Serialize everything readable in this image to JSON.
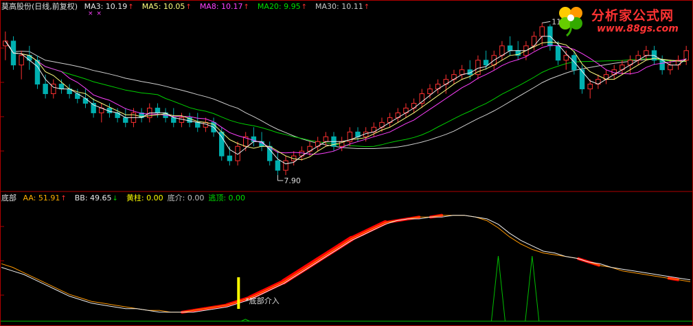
{
  "upper_panel": {
    "title": "莫高股份(日线,前复权)",
    "indicators": [
      {
        "label": "MA3: 10.19",
        "color": "#e8e8e8",
        "arrow": "up"
      },
      {
        "label": "MA5: 10.05",
        "color": "#ffff80",
        "arrow": "up"
      },
      {
        "label": "MA8: 10.17",
        "color": "#ff40ff",
        "arrow": "up"
      },
      {
        "label": "MA20: 9.95",
        "color": "#00e000",
        "arrow": "up"
      },
      {
        "label": "MA30: 10.11",
        "color": "#c8c8c8",
        "arrow": "up"
      }
    ],
    "markers": "× ×",
    "high_label": "11.08",
    "low_label": "7.90"
  },
  "lower_panel": {
    "title": "底部",
    "indicators": [
      {
        "label": "AA: 51.91",
        "color": "#ffb000",
        "arrow": "up"
      },
      {
        "label": "BB: 49.65",
        "color": "#e8e8e8",
        "arrow": "down"
      },
      {
        "label": "黄柱: 0.00",
        "color": "#ffff00",
        "arrow": ""
      },
      {
        "label": "底介: 0.00",
        "color": "#c0c0c0",
        "arrow": ""
      },
      {
        "label": "逃顶: 0.00",
        "color": "#00e000",
        "arrow": ""
      }
    ],
    "signal_label": "*底部介入"
  },
  "watermark": {
    "main": "分析家公式网",
    "sub": "www.88gs.com"
  },
  "colors": {
    "border": "#b00000",
    "candle_up": "#ff3030",
    "candle_down": "#00b0b0",
    "ma3": "#f0f0f0",
    "ma5": "#ffff80",
    "ma8": "#ff40ff",
    "ma20": "#00d000",
    "ma30": "#d0d0d0",
    "aa": "#ff9900",
    "bb": "#f0f0f0",
    "bottom_band": "#ff0000",
    "yellow_bar": "#ffff00",
    "top_spike": "#00c000"
  },
  "chart_data": {
    "type": "candlestick",
    "price_extremes": {
      "high": 11.08,
      "low": 7.9
    },
    "series": [
      {
        "name": "MA3",
        "last": 10.19
      },
      {
        "name": "MA5",
        "last": 10.05
      },
      {
        "name": "MA8",
        "last": 10.17
      },
      {
        "name": "MA20",
        "last": 9.95
      },
      {
        "name": "MA30",
        "last": 10.11
      }
    ],
    "candles": [
      [
        10.6,
        10.9,
        10.3,
        10.7
      ],
      [
        10.7,
        10.8,
        10.1,
        10.2
      ],
      [
        10.2,
        10.5,
        9.9,
        10.4
      ],
      [
        10.4,
        10.6,
        10.1,
        10.3
      ],
      [
        10.3,
        10.4,
        9.7,
        9.8
      ],
      [
        9.8,
        10.0,
        9.5,
        9.6
      ],
      [
        9.6,
        9.9,
        9.5,
        9.8
      ],
      [
        9.8,
        9.9,
        9.6,
        9.7
      ],
      [
        9.7,
        9.8,
        9.5,
        9.6
      ],
      [
        9.6,
        9.7,
        9.4,
        9.5
      ],
      [
        9.5,
        9.7,
        9.3,
        9.4
      ],
      [
        9.4,
        9.5,
        9.1,
        9.2
      ],
      [
        9.2,
        9.4,
        9.0,
        9.3
      ],
      [
        9.3,
        9.4,
        9.1,
        9.2
      ],
      [
        9.2,
        9.3,
        9.0,
        9.1
      ],
      [
        9.1,
        9.3,
        8.9,
        9.0
      ],
      [
        9.0,
        9.3,
        8.9,
        9.2
      ],
      [
        9.2,
        9.3,
        9.0,
        9.1
      ],
      [
        9.1,
        9.4,
        9.0,
        9.3
      ],
      [
        9.3,
        9.4,
        9.1,
        9.2
      ],
      [
        9.2,
        9.3,
        9.0,
        9.1
      ],
      [
        9.1,
        9.3,
        8.9,
        9.0
      ],
      [
        9.0,
        9.2,
        8.9,
        9.1
      ],
      [
        9.1,
        9.2,
        8.9,
        9.0
      ],
      [
        9.0,
        9.2,
        8.8,
        8.9
      ],
      [
        8.9,
        9.1,
        8.8,
        9.0
      ],
      [
        9.0,
        9.1,
        8.7,
        8.8
      ],
      [
        8.8,
        8.9,
        8.2,
        8.3
      ],
      [
        8.3,
        8.5,
        8.1,
        8.2
      ],
      [
        8.2,
        8.6,
        8.1,
        8.5
      ],
      [
        8.5,
        8.8,
        8.4,
        8.7
      ],
      [
        8.7,
        8.9,
        8.5,
        8.6
      ],
      [
        8.6,
        8.8,
        8.4,
        8.5
      ],
      [
        8.5,
        8.6,
        8.1,
        8.2
      ],
      [
        8.2,
        8.4,
        7.9,
        8.0
      ],
      [
        8.0,
        8.3,
        7.9,
        8.2
      ],
      [
        8.2,
        8.4,
        8.1,
        8.3
      ],
      [
        8.3,
        8.5,
        8.2,
        8.4
      ],
      [
        8.4,
        8.6,
        8.3,
        8.5
      ],
      [
        8.5,
        8.7,
        8.4,
        8.6
      ],
      [
        8.6,
        8.8,
        8.5,
        8.7
      ],
      [
        8.7,
        8.8,
        8.4,
        8.5
      ],
      [
        8.5,
        8.7,
        8.4,
        8.6
      ],
      [
        8.6,
        8.9,
        8.5,
        8.8
      ],
      [
        8.8,
        8.9,
        8.6,
        8.7
      ],
      [
        8.7,
        8.9,
        8.6,
        8.8
      ],
      [
        8.8,
        9.0,
        8.7,
        8.9
      ],
      [
        8.9,
        9.1,
        8.8,
        9.0
      ],
      [
        9.0,
        9.2,
        8.9,
        9.1
      ],
      [
        9.1,
        9.3,
        9.0,
        9.2
      ],
      [
        9.2,
        9.4,
        9.1,
        9.3
      ],
      [
        9.3,
        9.5,
        9.2,
        9.4
      ],
      [
        9.4,
        9.7,
        9.3,
        9.6
      ],
      [
        9.6,
        9.8,
        9.5,
        9.7
      ],
      [
        9.7,
        9.9,
        9.6,
        9.8
      ],
      [
        9.8,
        10.0,
        9.6,
        9.9
      ],
      [
        9.9,
        10.1,
        9.8,
        10.0
      ],
      [
        10.0,
        10.2,
        9.9,
        10.1
      ],
      [
        10.1,
        10.3,
        9.9,
        10.0
      ],
      [
        10.0,
        10.4,
        9.9,
        10.3
      ],
      [
        10.3,
        10.5,
        10.1,
        10.2
      ],
      [
        10.2,
        10.5,
        10.1,
        10.4
      ],
      [
        10.4,
        10.7,
        10.3,
        10.6
      ],
      [
        10.6,
        10.8,
        10.4,
        10.5
      ],
      [
        10.5,
        10.7,
        10.3,
        10.4
      ],
      [
        10.4,
        10.7,
        10.3,
        10.6
      ],
      [
        10.6,
        10.9,
        10.5,
        10.8
      ],
      [
        10.8,
        11.08,
        10.6,
        11.0
      ],
      [
        11.0,
        11.05,
        10.5,
        10.6
      ],
      [
        10.6,
        10.7,
        10.2,
        10.3
      ],
      [
        10.3,
        10.5,
        10.1,
        10.4
      ],
      [
        10.4,
        10.5,
        10.0,
        10.1
      ],
      [
        10.1,
        10.2,
        9.6,
        9.7
      ],
      [
        9.7,
        9.9,
        9.5,
        9.8
      ],
      [
        9.8,
        10.0,
        9.7,
        9.9
      ],
      [
        9.9,
        10.1,
        9.8,
        10.0
      ],
      [
        10.0,
        10.2,
        9.9,
        10.1
      ],
      [
        10.1,
        10.3,
        10.0,
        10.2
      ],
      [
        10.2,
        10.4,
        10.0,
        10.3
      ],
      [
        10.3,
        10.5,
        10.2,
        10.4
      ],
      [
        10.4,
        10.6,
        10.3,
        10.5
      ],
      [
        10.5,
        10.6,
        10.2,
        10.3
      ],
      [
        10.3,
        10.4,
        10.0,
        10.1
      ],
      [
        10.1,
        10.3,
        10.0,
        10.2
      ],
      [
        10.2,
        10.4,
        10.1,
        10.3
      ],
      [
        10.3,
        10.6,
        10.2,
        10.5
      ]
    ],
    "indicator_aa": [
      62,
      60,
      57,
      54,
      51,
      48,
      45,
      43,
      41,
      40,
      39,
      38,
      37,
      36,
      36,
      35,
      35,
      36,
      37,
      38,
      39,
      41,
      43,
      46,
      49,
      52,
      56,
      60,
      64,
      68,
      72,
      76,
      79,
      82,
      85,
      86,
      87,
      88,
      88,
      89,
      89,
      89,
      88,
      86,
      82,
      77,
      73,
      70,
      68,
      67,
      66,
      65,
      63,
      61,
      60,
      58,
      57,
      56,
      55,
      54,
      53,
      52
    ],
    "indicator_bb": [
      60,
      58,
      56,
      53,
      50,
      47,
      44,
      42,
      40,
      39,
      38,
      37,
      37,
      36,
      35,
      35,
      35,
      35,
      36,
      37,
      38,
      40,
      42,
      45,
      48,
      51,
      55,
      59,
      63,
      67,
      71,
      75,
      78,
      81,
      84,
      86,
      87,
      87,
      88,
      88,
      89,
      89,
      88,
      87,
      84,
      79,
      75,
      72,
      69,
      68,
      66,
      65,
      63,
      62,
      60,
      59,
      58,
      57,
      56,
      55,
      54,
      53
    ],
    "signals": {
      "bottom_entry_index": 21,
      "top_escape_indices": [
        44,
        47
      ]
    }
  }
}
